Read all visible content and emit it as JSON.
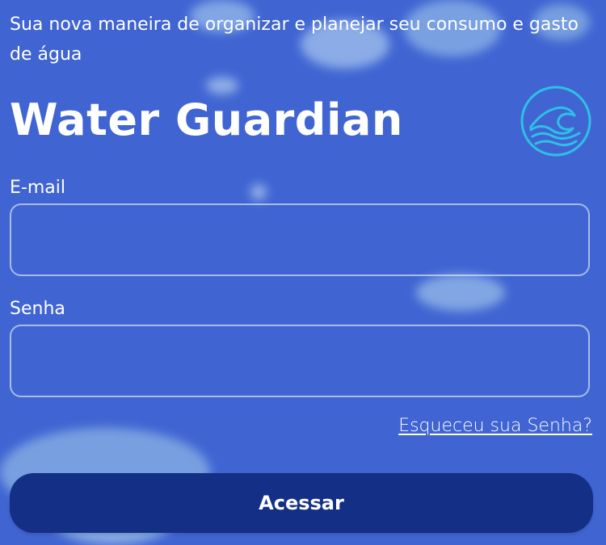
{
  "tagline": "Sua nova maneira de organizar e planejar seu consumo e gasto de água",
  "app_title": "Water Guardian",
  "logo": {
    "icon": "wave-icon",
    "color": "#2ec0e6"
  },
  "form": {
    "email_label": "E-mail",
    "email_value": "",
    "password_label": "Senha",
    "password_value": "",
    "forgot_password": "Esqueceu sua Senha?",
    "submit_label": "Acessar"
  },
  "colors": {
    "background": "#4065d2",
    "button": "#142f86",
    "text": "#ffffff"
  }
}
